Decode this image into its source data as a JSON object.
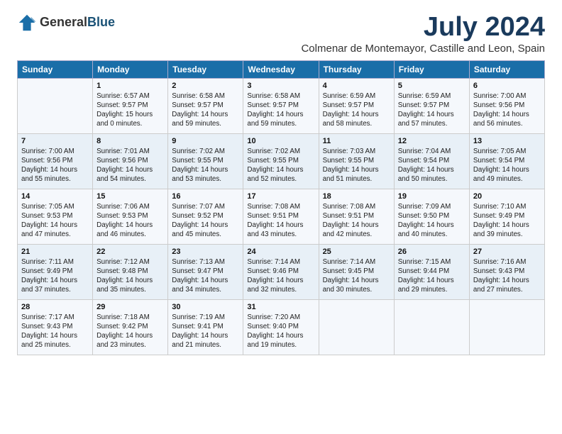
{
  "header": {
    "logo_general": "General",
    "logo_blue": "Blue",
    "title": "July 2024",
    "subtitle": "Colmenar de Montemayor, Castille and Leon, Spain"
  },
  "columns": [
    "Sunday",
    "Monday",
    "Tuesday",
    "Wednesday",
    "Thursday",
    "Friday",
    "Saturday"
  ],
  "weeks": [
    [
      {
        "num": "",
        "info": ""
      },
      {
        "num": "1",
        "info": "Sunrise: 6:57 AM\nSunset: 9:57 PM\nDaylight: 15 hours\nand 0 minutes."
      },
      {
        "num": "2",
        "info": "Sunrise: 6:58 AM\nSunset: 9:57 PM\nDaylight: 14 hours\nand 59 minutes."
      },
      {
        "num": "3",
        "info": "Sunrise: 6:58 AM\nSunset: 9:57 PM\nDaylight: 14 hours\nand 59 minutes."
      },
      {
        "num": "4",
        "info": "Sunrise: 6:59 AM\nSunset: 9:57 PM\nDaylight: 14 hours\nand 58 minutes."
      },
      {
        "num": "5",
        "info": "Sunrise: 6:59 AM\nSunset: 9:57 PM\nDaylight: 14 hours\nand 57 minutes."
      },
      {
        "num": "6",
        "info": "Sunrise: 7:00 AM\nSunset: 9:56 PM\nDaylight: 14 hours\nand 56 minutes."
      }
    ],
    [
      {
        "num": "7",
        "info": "Sunrise: 7:00 AM\nSunset: 9:56 PM\nDaylight: 14 hours\nand 55 minutes."
      },
      {
        "num": "8",
        "info": "Sunrise: 7:01 AM\nSunset: 9:56 PM\nDaylight: 14 hours\nand 54 minutes."
      },
      {
        "num": "9",
        "info": "Sunrise: 7:02 AM\nSunset: 9:55 PM\nDaylight: 14 hours\nand 53 minutes."
      },
      {
        "num": "10",
        "info": "Sunrise: 7:02 AM\nSunset: 9:55 PM\nDaylight: 14 hours\nand 52 minutes."
      },
      {
        "num": "11",
        "info": "Sunrise: 7:03 AM\nSunset: 9:55 PM\nDaylight: 14 hours\nand 51 minutes."
      },
      {
        "num": "12",
        "info": "Sunrise: 7:04 AM\nSunset: 9:54 PM\nDaylight: 14 hours\nand 50 minutes."
      },
      {
        "num": "13",
        "info": "Sunrise: 7:05 AM\nSunset: 9:54 PM\nDaylight: 14 hours\nand 49 minutes."
      }
    ],
    [
      {
        "num": "14",
        "info": "Sunrise: 7:05 AM\nSunset: 9:53 PM\nDaylight: 14 hours\nand 47 minutes."
      },
      {
        "num": "15",
        "info": "Sunrise: 7:06 AM\nSunset: 9:53 PM\nDaylight: 14 hours\nand 46 minutes."
      },
      {
        "num": "16",
        "info": "Sunrise: 7:07 AM\nSunset: 9:52 PM\nDaylight: 14 hours\nand 45 minutes."
      },
      {
        "num": "17",
        "info": "Sunrise: 7:08 AM\nSunset: 9:51 PM\nDaylight: 14 hours\nand 43 minutes."
      },
      {
        "num": "18",
        "info": "Sunrise: 7:08 AM\nSunset: 9:51 PM\nDaylight: 14 hours\nand 42 minutes."
      },
      {
        "num": "19",
        "info": "Sunrise: 7:09 AM\nSunset: 9:50 PM\nDaylight: 14 hours\nand 40 minutes."
      },
      {
        "num": "20",
        "info": "Sunrise: 7:10 AM\nSunset: 9:49 PM\nDaylight: 14 hours\nand 39 minutes."
      }
    ],
    [
      {
        "num": "21",
        "info": "Sunrise: 7:11 AM\nSunset: 9:49 PM\nDaylight: 14 hours\nand 37 minutes."
      },
      {
        "num": "22",
        "info": "Sunrise: 7:12 AM\nSunset: 9:48 PM\nDaylight: 14 hours\nand 35 minutes."
      },
      {
        "num": "23",
        "info": "Sunrise: 7:13 AM\nSunset: 9:47 PM\nDaylight: 14 hours\nand 34 minutes."
      },
      {
        "num": "24",
        "info": "Sunrise: 7:14 AM\nSunset: 9:46 PM\nDaylight: 14 hours\nand 32 minutes."
      },
      {
        "num": "25",
        "info": "Sunrise: 7:14 AM\nSunset: 9:45 PM\nDaylight: 14 hours\nand 30 minutes."
      },
      {
        "num": "26",
        "info": "Sunrise: 7:15 AM\nSunset: 9:44 PM\nDaylight: 14 hours\nand 29 minutes."
      },
      {
        "num": "27",
        "info": "Sunrise: 7:16 AM\nSunset: 9:43 PM\nDaylight: 14 hours\nand 27 minutes."
      }
    ],
    [
      {
        "num": "28",
        "info": "Sunrise: 7:17 AM\nSunset: 9:43 PM\nDaylight: 14 hours\nand 25 minutes."
      },
      {
        "num": "29",
        "info": "Sunrise: 7:18 AM\nSunset: 9:42 PM\nDaylight: 14 hours\nand 23 minutes."
      },
      {
        "num": "30",
        "info": "Sunrise: 7:19 AM\nSunset: 9:41 PM\nDaylight: 14 hours\nand 21 minutes."
      },
      {
        "num": "31",
        "info": "Sunrise: 7:20 AM\nSunset: 9:40 PM\nDaylight: 14 hours\nand 19 minutes."
      },
      {
        "num": "",
        "info": ""
      },
      {
        "num": "",
        "info": ""
      },
      {
        "num": "",
        "info": ""
      }
    ]
  ]
}
